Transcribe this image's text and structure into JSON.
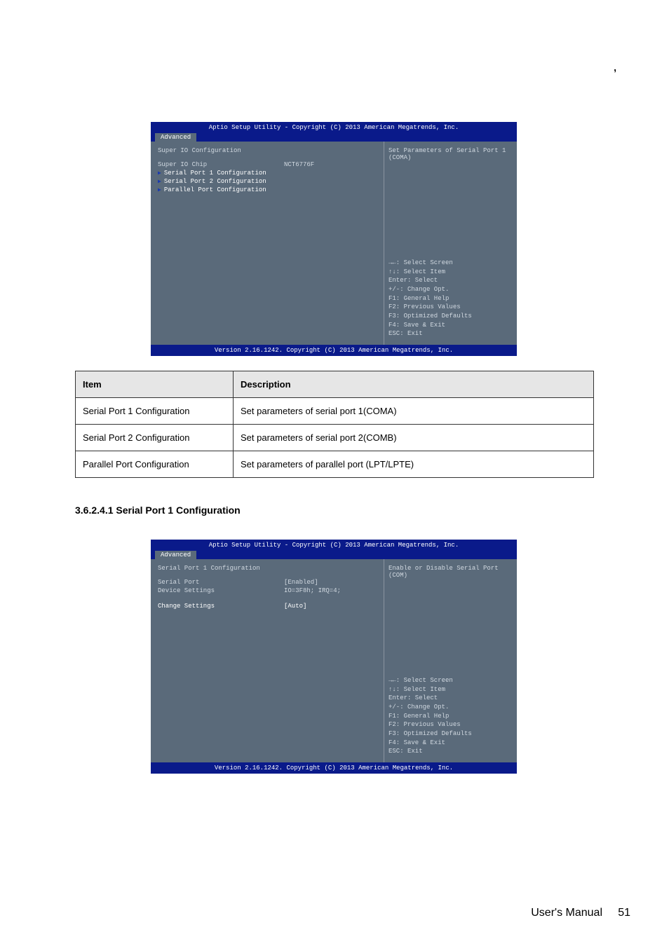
{
  "comma": ",",
  "header_title": "Aptio Setup Utility - Copyright (C) 2013 American Megatrends, Inc.",
  "tab_label": "Advanced",
  "footer_version": "Version 2.16.1242. Copyright (C) 2013 American Megatrends, Inc.",
  "help_keys": {
    "k1": "→←: Select Screen",
    "k2": "↑↓: Select Item",
    "k3": "Enter: Select",
    "k4": "+/-: Change Opt.",
    "k5": "F1: General Help",
    "k6": "F2: Previous Values",
    "k7": "F3: Optimized Defaults",
    "k8": "F4: Save & Exit",
    "k9": "ESC: Exit"
  },
  "bios1": {
    "section": "Super IO Configuration",
    "chip_label": "Super IO Chip",
    "chip_value": "NCT6776F",
    "sub1": "Serial Port 1 Configuration",
    "sub2": "Serial Port 2 Configuration",
    "sub3": "Parallel Port Configuration",
    "help_desc": "Set Parameters of Serial Port 1 (COMA)"
  },
  "bios2": {
    "section": "Serial Port 1 Configuration",
    "sp_label": "Serial Port",
    "sp_value": "[Enabled]",
    "dev_label": "Device Settings",
    "dev_value": "IO=3F8h; IRQ=4;",
    "chg_label": "Change Settings",
    "chg_value": "[Auto]",
    "help_desc": "Enable or Disable Serial Port (COM)"
  },
  "table": {
    "h1": "Item",
    "h2": "Description",
    "r1c1": "Serial Port 1 Configuration",
    "r1c2": "Set parameters of serial port 1(COMA)",
    "r2c1": "Serial Port 2 Configuration",
    "r2c2": "Set parameters of serial port 2(COMB)",
    "r3c1": "Parallel Port Configuration",
    "r3c2": "Set parameters of parallel port (LPT/LPTE)"
  },
  "subsection_a": "3.6.2.4.1 Serial Port 1 Configuration",
  "footer_text": "User's  Manual",
  "page_num": "51"
}
